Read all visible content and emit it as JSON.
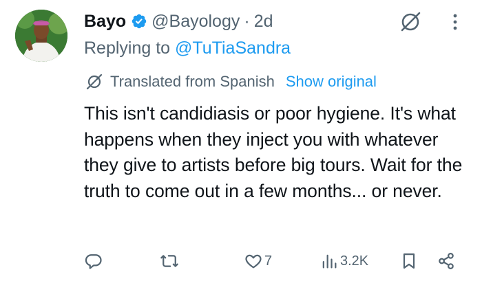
{
  "tweet": {
    "author_name": "Bayo",
    "handle": "@Bayology",
    "separator": "·",
    "time": "2d",
    "reply_prefix": "Replying to",
    "reply_to": "@TuTiaSandra",
    "translated_label": "Translated from Spanish",
    "show_original": "Show original",
    "text": "This isn't candidiasis or poor hygiene. It's what happens when they inject you with whatever they give to artists before big tours. Wait for the truth to come out in a few months... or never."
  },
  "actions": {
    "likes": "7",
    "views": "3.2K"
  },
  "colors": {
    "accent": "#1d9bf0",
    "text": "#0f1419",
    "secondary": "#536471"
  }
}
